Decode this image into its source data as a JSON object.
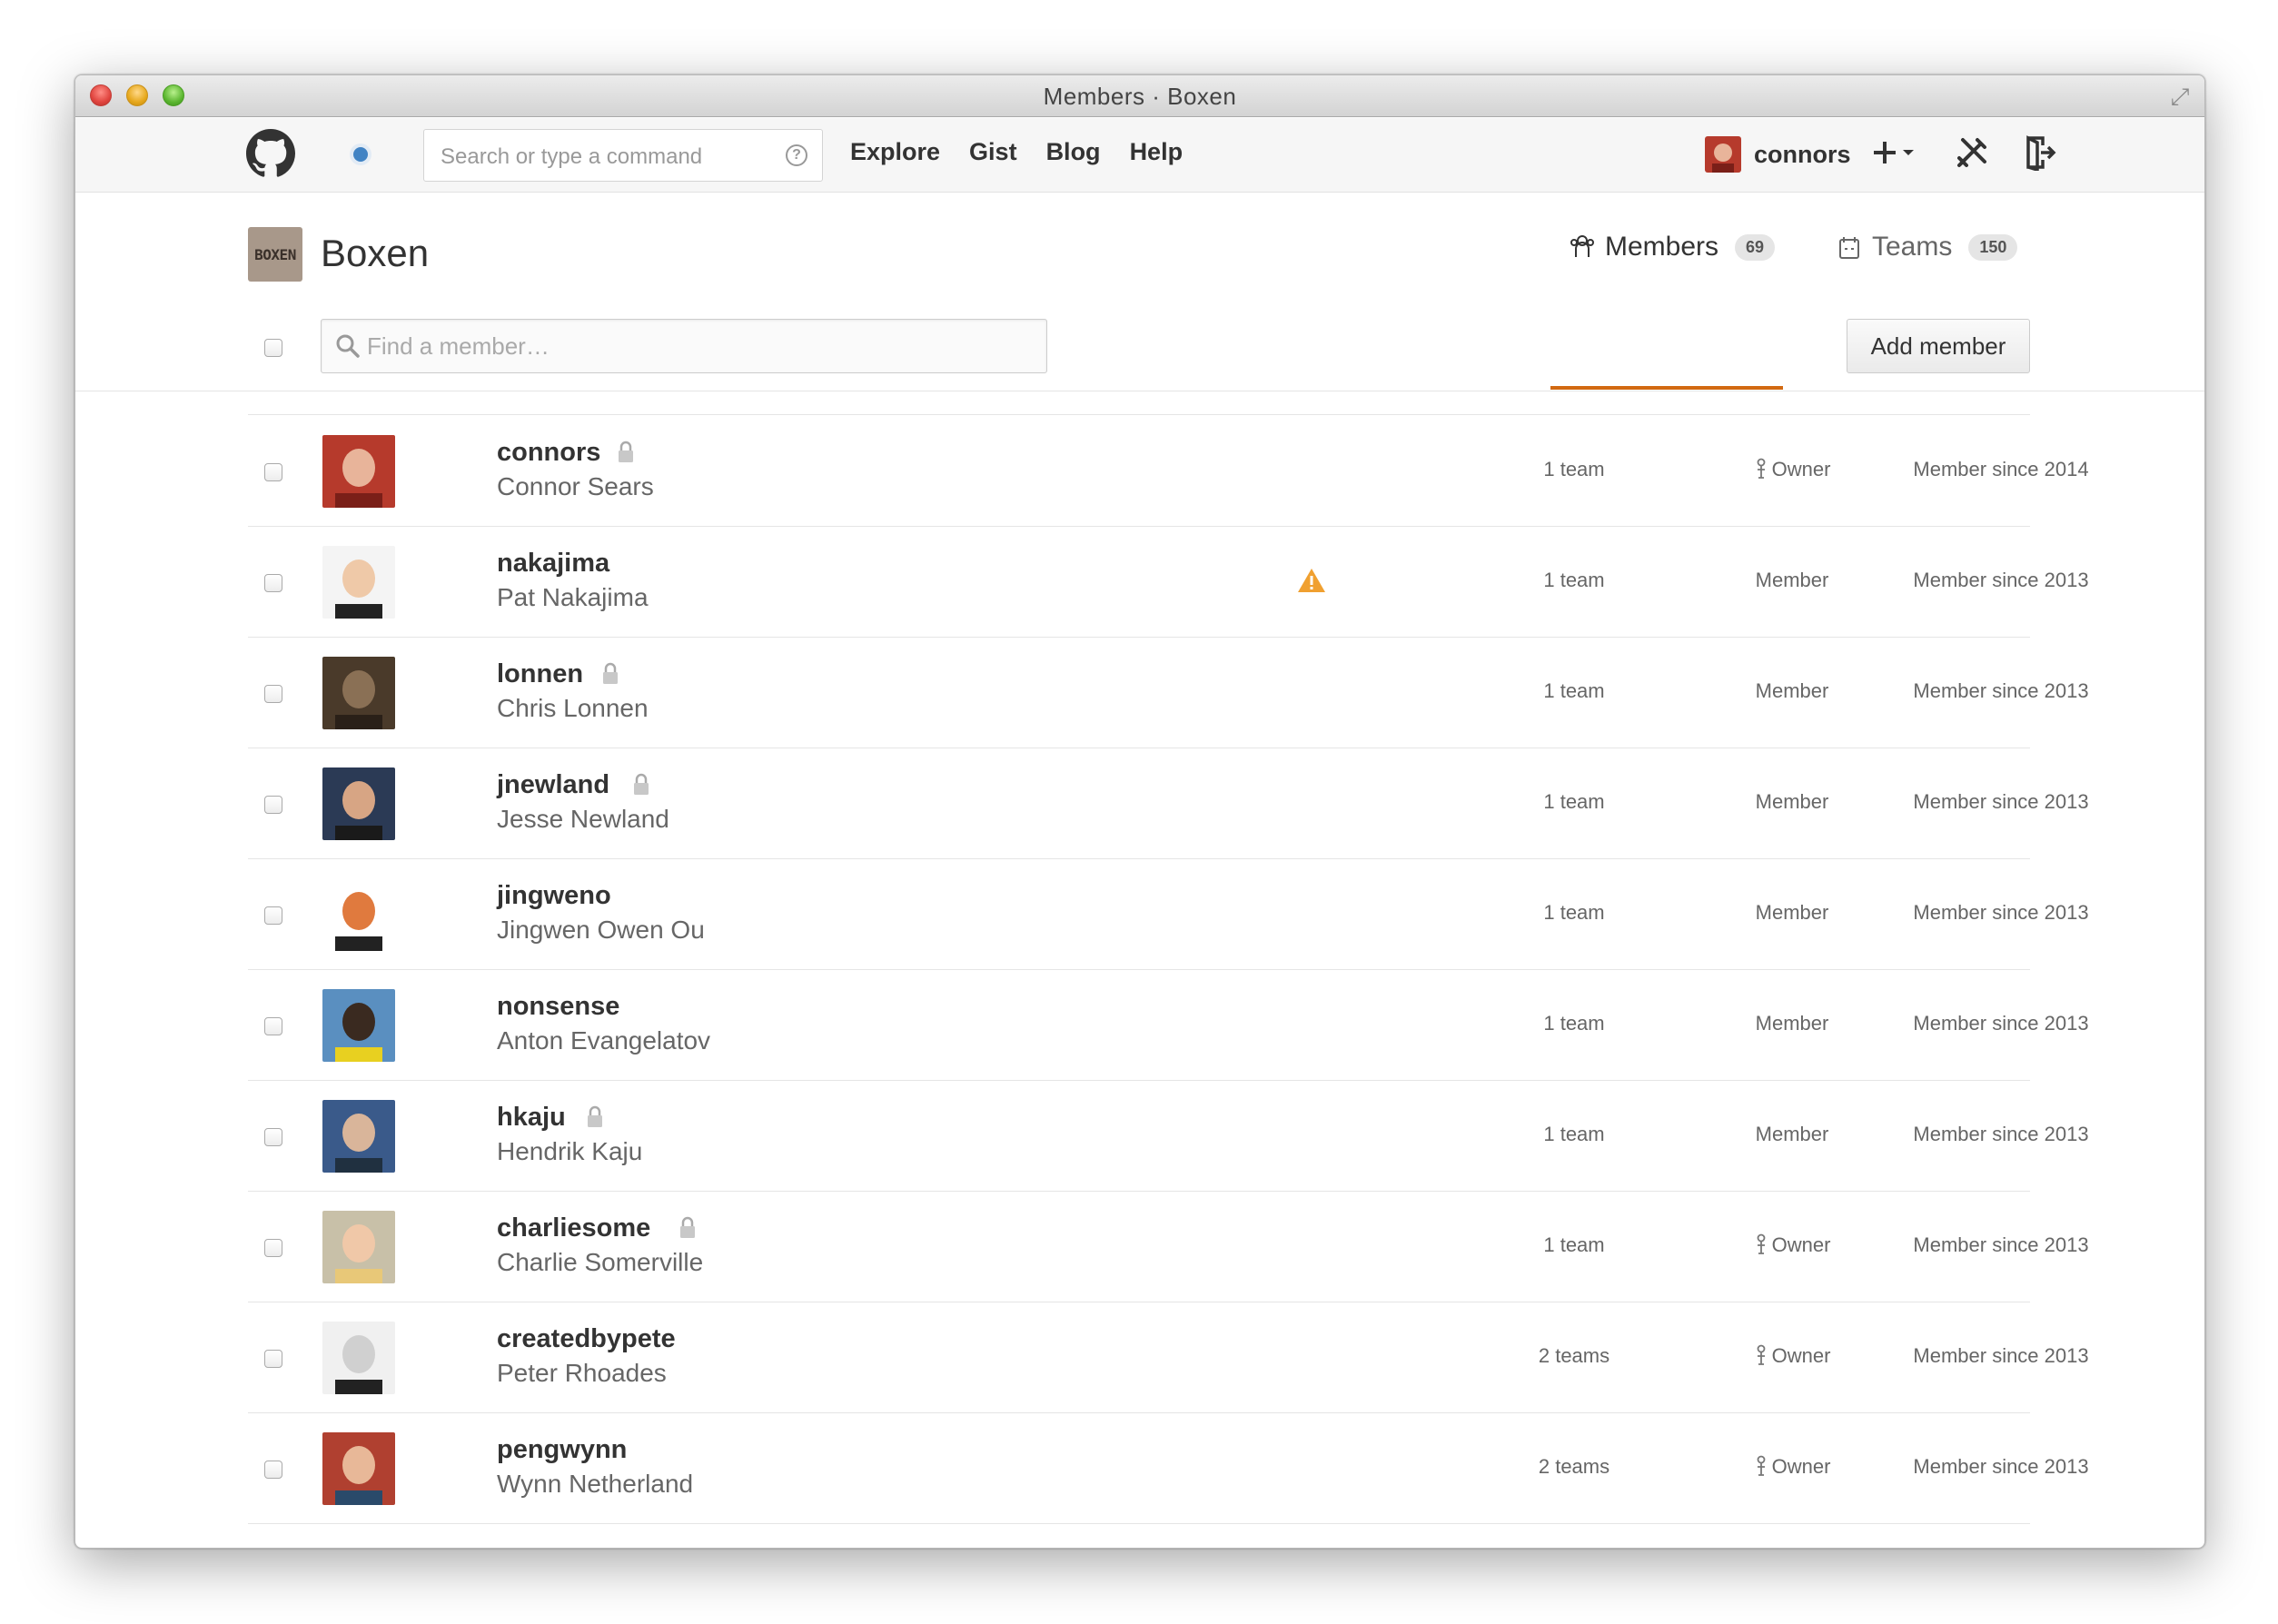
{
  "window": {
    "title": "Members · Boxen"
  },
  "nav": {
    "search_placeholder": "Search or type a command",
    "links": [
      "Explore",
      "Gist",
      "Blog",
      "Help"
    ],
    "username": "connors"
  },
  "org": {
    "logo_text": "BOXEN",
    "name": "Boxen",
    "tabs": [
      {
        "label": "Members",
        "count": "69"
      },
      {
        "label": "Teams",
        "count": "150"
      }
    ]
  },
  "toolbar": {
    "find_placeholder": "Find a member…",
    "add_member_label": "Add member"
  },
  "members": [
    {
      "login": "connors",
      "name": "Connor Sears",
      "locked": true,
      "warning": false,
      "teams": "1 team",
      "role": "Owner",
      "since": "Member since 2014"
    },
    {
      "login": "nakajima",
      "name": "Pat Nakajima",
      "locked": false,
      "warning": true,
      "teams": "1 team",
      "role": "Member",
      "since": "Member since 2013"
    },
    {
      "login": "lonnen",
      "name": "Chris Lonnen",
      "locked": true,
      "warning": false,
      "teams": "1 team",
      "role": "Member",
      "since": "Member since 2013"
    },
    {
      "login": "jnewland",
      "name": "Jesse Newland",
      "locked": true,
      "warning": false,
      "teams": "1 team",
      "role": "Member",
      "since": "Member since 2013"
    },
    {
      "login": "jingweno",
      "name": "Jingwen Owen Ou",
      "locked": false,
      "warning": false,
      "teams": "1 team",
      "role": "Member",
      "since": "Member since 2013"
    },
    {
      "login": "nonsense",
      "name": "Anton Evangelatov",
      "locked": false,
      "warning": false,
      "teams": "1 team",
      "role": "Member",
      "since": "Member since 2013"
    },
    {
      "login": "hkaju",
      "name": "Hendrik Kaju",
      "locked": true,
      "warning": false,
      "teams": "1 team",
      "role": "Member",
      "since": "Member since 2013"
    },
    {
      "login": "charliesome",
      "name": "Charlie Somerville",
      "locked": true,
      "warning": false,
      "teams": "1 team",
      "role": "Owner",
      "since": "Member since 2013"
    },
    {
      "login": "createdbypete",
      "name": "Peter Rhoades",
      "locked": false,
      "warning": false,
      "teams": "2 teams",
      "role": "Owner",
      "since": "Member since 2013"
    },
    {
      "login": "pengwynn",
      "name": "Wynn Netherland",
      "locked": false,
      "warning": false,
      "teams": "2 teams",
      "role": "Owner",
      "since": "Member since 2013"
    }
  ],
  "colors": {
    "accent_tab_underline": "#d26911",
    "warning": "#f0a030",
    "notification": "#4183c4"
  }
}
